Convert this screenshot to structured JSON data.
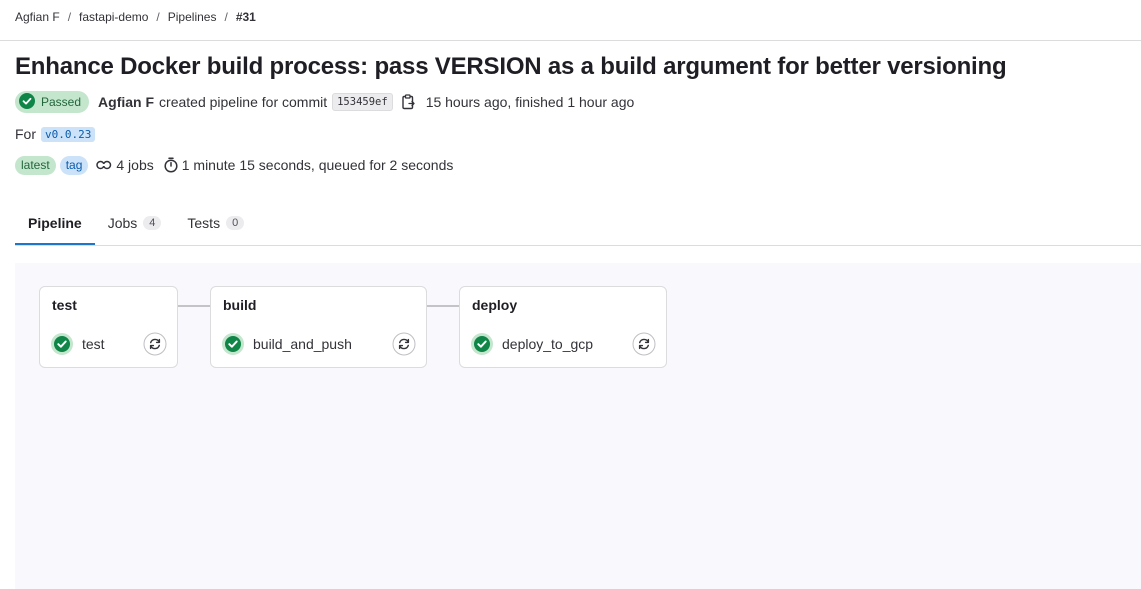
{
  "breadcrumb": {
    "items": [
      "Agfian F",
      "fastapi-demo",
      "Pipelines"
    ],
    "current": "#31",
    "separator": "/"
  },
  "pipeline": {
    "title": "Enhance Docker build process: pass VERSION as a build argument for better versioning",
    "status_label": "Passed",
    "author": "Agfian F",
    "created_text": "created pipeline for commit",
    "commit_sha": "153459ef",
    "time_text": "15 hours ago, finished 1 hour ago",
    "for_label": "For",
    "ref": "v0.0.23",
    "badges": [
      "latest",
      "tag"
    ],
    "jobs_text": "4 jobs",
    "duration_text": "1 minute 15 seconds, queued for 2 seconds"
  },
  "tabs": [
    {
      "label": "Pipeline",
      "count": null
    },
    {
      "label": "Jobs",
      "count": "4"
    },
    {
      "label": "Tests",
      "count": "0"
    }
  ],
  "stages": [
    {
      "name": "test",
      "jobs": [
        {
          "name": "test",
          "status": "passed"
        }
      ]
    },
    {
      "name": "build",
      "jobs": [
        {
          "name": "build_and_push",
          "status": "passed"
        }
      ]
    },
    {
      "name": "deploy",
      "jobs": [
        {
          "name": "deploy_to_gcp",
          "status": "passed"
        }
      ]
    }
  ],
  "icons": {
    "status": "check-circle-icon",
    "copy": "copy-icon",
    "jobs": "pipeline-link-icon",
    "duration": "timer-icon",
    "retry": "retry-icon"
  },
  "colors": {
    "success": "#108548",
    "success_bg": "#c3e6cd",
    "success_text": "#24663b",
    "tag_bg": "#cbe2f9",
    "tag_text": "#0b5cad",
    "active_tab": "#1f75cb"
  }
}
